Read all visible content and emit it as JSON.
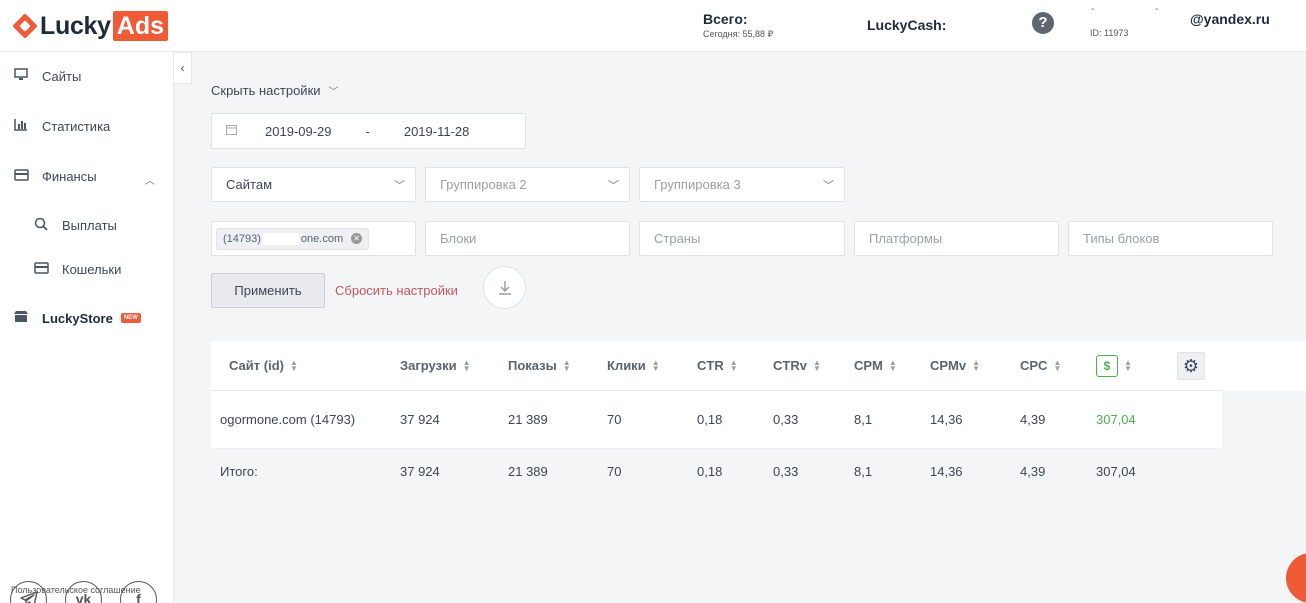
{
  "header": {
    "logo_lucky": "Lucky",
    "logo_ads": "Ads",
    "total_label": "Всего:",
    "today_label": "Сегодня: 55,88 ₽",
    "luckycash_label": "LuckyCash:",
    "help_glyph": "?",
    "user_id": "ID: 11973",
    "email": "@yandex.ru",
    "redacted_1": "-",
    "redacted_2": "-"
  },
  "sidebar": {
    "items": [
      {
        "label": "Сайты",
        "icon": "monitor-icon"
      },
      {
        "label": "Статистика",
        "icon": "chart-icon"
      },
      {
        "label": "Финансы",
        "icon": "card-icon"
      },
      {
        "label": "Выплаты",
        "icon": "search-money-icon"
      },
      {
        "label": "Кошельки",
        "icon": "wallet-icon"
      },
      {
        "label": "LuckyStore",
        "icon": "store-icon",
        "badge": "NEW"
      }
    ],
    "social": [
      "telegram-icon",
      "vk-icon",
      "facebook-icon"
    ],
    "agreement": "Пользовательское соглашение"
  },
  "filters": {
    "hide_settings": "Скрыть настройки",
    "date_from": "2019-09-29",
    "date_sep": "-",
    "date_to": "2019-11-28",
    "group1": "Сайтам",
    "group2": "Группировка 2",
    "group3": "Группировка 3",
    "site_chip_id": "(14793)",
    "site_chip_name": "one.com",
    "blocks_placeholder": "Блоки",
    "countries_placeholder": "Страны",
    "platforms_placeholder": "Платформы",
    "block_types_placeholder": "Типы блоков",
    "apply": "Применить",
    "reset": "Сбросить настройки"
  },
  "table": {
    "columns": [
      "Сайт (id)",
      "Загрузки",
      "Показы",
      "Клики",
      "CTR",
      "CTRv",
      "CPM",
      "CPMv",
      "CPC"
    ],
    "rows": [
      [
        "ogormone.com (14793)",
        "37 924",
        "21 389",
        "70",
        "0,18",
        "0,33",
        "8,1",
        "14,36",
        "4,39",
        "307,04"
      ]
    ],
    "total": [
      "Итого:",
      "37 924",
      "21 389",
      "70",
      "0,18",
      "0,33",
      "8,1",
      "14,36",
      "4,39",
      "307,04"
    ],
    "income_color": "#4caf50"
  }
}
